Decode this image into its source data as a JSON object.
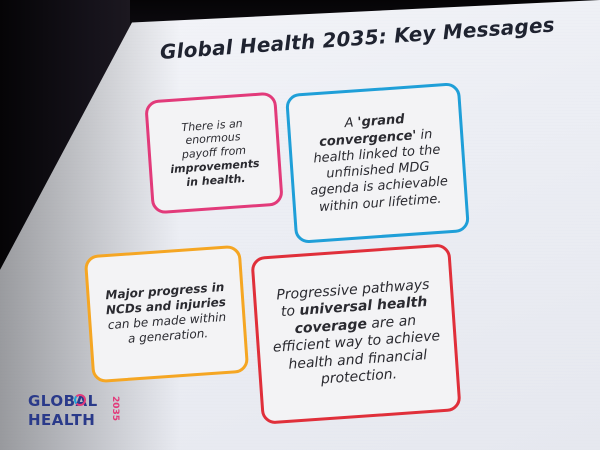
{
  "slide": {
    "title": "Global Health 2035: Key Messages",
    "cards": [
      {
        "lines": [
          "There is an enormous",
          "payoff from"
        ],
        "bold": "improvements in health.",
        "border_color": "#e23a7a"
      },
      {
        "pre": "A ",
        "bold": "'grand convergence'",
        "post": " in health linked to the unfinished MDG agenda is achievable within our lifetime.",
        "border_color": "#1f9fd8"
      },
      {
        "bold": "Major progress in NCDs and injuries",
        "post": " can be made within a generation.",
        "border_color": "#f5a623"
      },
      {
        "pre": "Progressive pathways to ",
        "bold": "universal health coverage",
        "post": " are an efficient way to achieve health and financial protection.",
        "border_color": "#e02f3a"
      }
    ],
    "logo": {
      "line1": "GLOBAL",
      "line2": "HEALTH",
      "number": "2035"
    }
  }
}
